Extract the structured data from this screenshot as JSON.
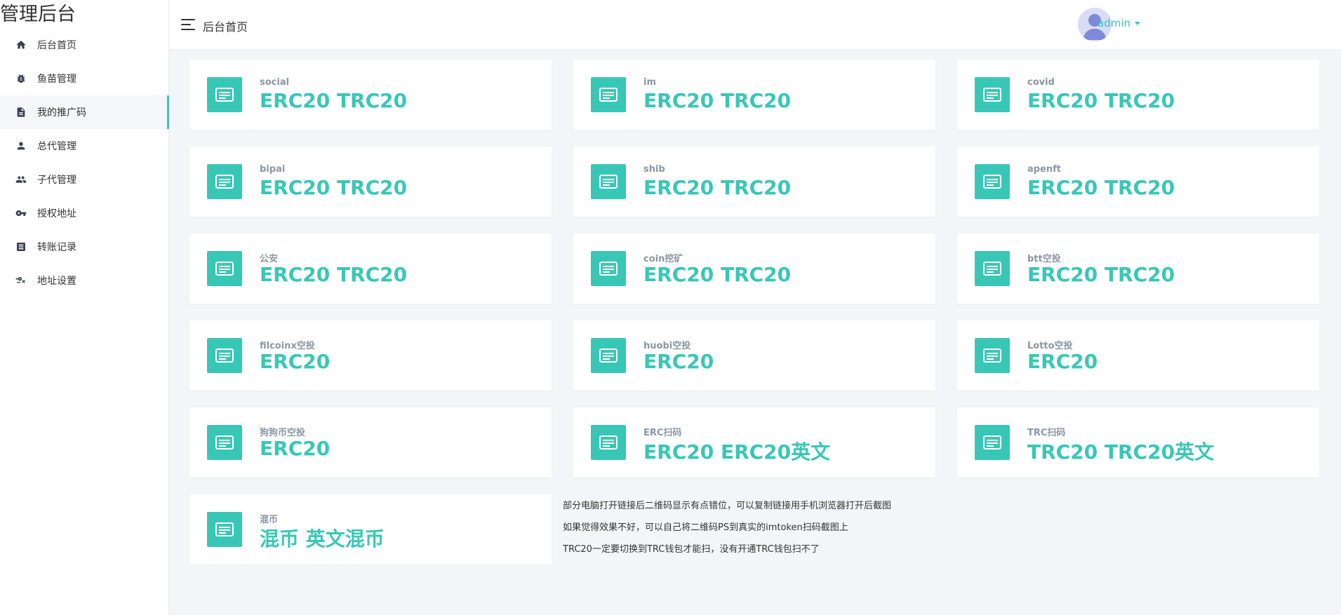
{
  "sidebar": {
    "brand": "管理后台",
    "items": [
      {
        "label": "后台首页",
        "icon": "home-icon"
      },
      {
        "label": "鱼苗管理",
        "icon": "bug-icon"
      },
      {
        "label": "我的推广码",
        "icon": "document-icon",
        "active": true
      },
      {
        "label": "总代管理",
        "icon": "person-icon"
      },
      {
        "label": "子代管理",
        "icon": "people-icon"
      },
      {
        "label": "授权地址",
        "icon": "key-icon"
      },
      {
        "label": "转账记录",
        "icon": "receipt-icon"
      },
      {
        "label": "地址设置",
        "icon": "key-settings-icon"
      }
    ]
  },
  "header": {
    "breadcrumb": "后台首页",
    "username": "admin"
  },
  "cards": [
    {
      "title": "social",
      "value": "ERC20 TRC20"
    },
    {
      "title": "im",
      "value": "ERC20 TRC20"
    },
    {
      "title": "covid",
      "value": "ERC20 TRC20"
    },
    {
      "title": "bipai",
      "value": "ERC20 TRC20"
    },
    {
      "title": "shib",
      "value": "ERC20 TRC20"
    },
    {
      "title": "apenft",
      "value": "ERC20 TRC20"
    },
    {
      "title": "公安",
      "value": "ERC20 TRC20"
    },
    {
      "title": "coin挖矿",
      "value": "ERC20 TRC20"
    },
    {
      "title": "btt空投",
      "value": "ERC20 TRC20"
    },
    {
      "title": "filcoinx空投",
      "value": "ERC20"
    },
    {
      "title": "huobi空投",
      "value": "ERC20"
    },
    {
      "title": "Lotto空投",
      "value": "ERC20"
    },
    {
      "title": "狗狗币空投",
      "value": "ERC20"
    },
    {
      "title": "ERC扫码",
      "value": "ERC20 ERC20英文"
    },
    {
      "title": "TRC扫码",
      "value": "TRC20 TRC20英文"
    },
    {
      "title": "混币",
      "value": "混币 英文混币"
    }
  ],
  "notes": [
    "部分电脑打开链接后二维码显示有点错位，可以复制链接用手机浏览器打开后截图",
    "如果觉得效果不好，可以自己将二维码PS到真实的imtoken扫码截图上",
    "TRC20一定要切换到TRC钱包才能扫，没有开通TRC钱包扫不了"
  ],
  "colors": {
    "accent": "#38c7b6",
    "muted": "#8a96a3"
  }
}
